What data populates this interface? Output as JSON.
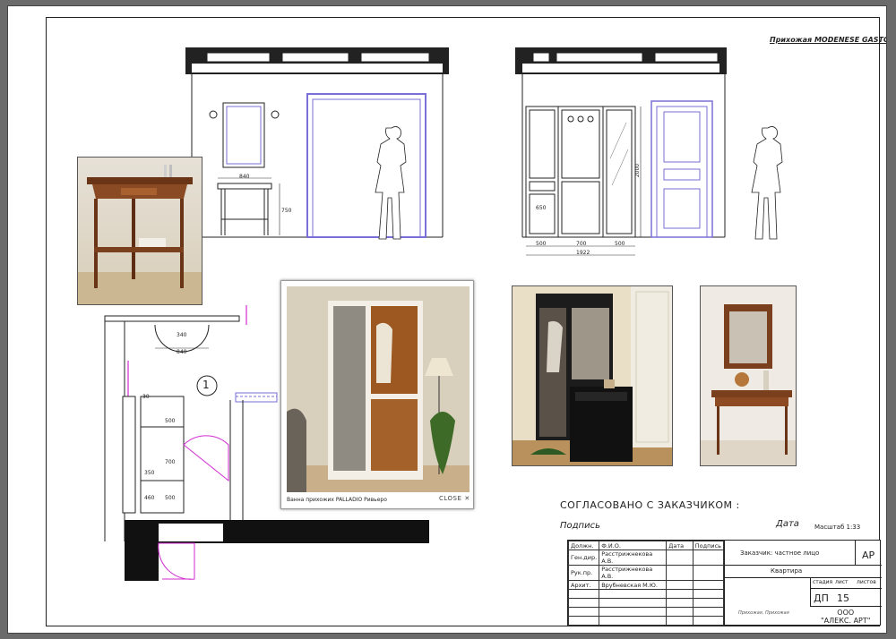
{
  "sheet": {
    "title": "Прихожая MODENESE GASTONE",
    "room_number": "1",
    "approval": "СОГЛАСОВАНО С ЗАКАЗЧИКОМ :",
    "signature_label": "Подпись",
    "date_label": "Дата",
    "scale": "Масштаб 1:33"
  },
  "elevation_left": {
    "dim_width": "840",
    "dim_height": "750"
  },
  "elevation_right": {
    "dim_height": "2000",
    "dim_650": "650",
    "dims_bottom": [
      "500",
      "700",
      "500"
    ],
    "dim_total": "1922"
  },
  "plan": {
    "dims": [
      "340",
      "840",
      "30",
      "500",
      "700",
      "350",
      "460",
      "500"
    ]
  },
  "popup": {
    "caption": "Ванна прихожих PALLADIO Ривьеро",
    "close_label": "CLOSE"
  },
  "stamp": {
    "headers": [
      "Должн.",
      "Ф.И.О.",
      "Дата",
      "Подпись"
    ],
    "rows": [
      [
        "Ген.дир.",
        "Расстрижнекова А.В."
      ],
      [
        "Рук.пр.",
        "Расстрижнекова А.В."
      ],
      [
        "Архит.",
        "Врубневская М.Ю."
      ]
    ],
    "client": "Заказчик:  частное лицо",
    "object": "Квартира",
    "code": "АР",
    "stage_label": "стадия",
    "sheet_label": "лист",
    "sheets_label": "листов",
    "stage": "ДП",
    "sheet_no": "15",
    "company_small": "Прихожая, Прихожая",
    "company": "ООО\n\"АЛЕКС. АРТ\""
  }
}
